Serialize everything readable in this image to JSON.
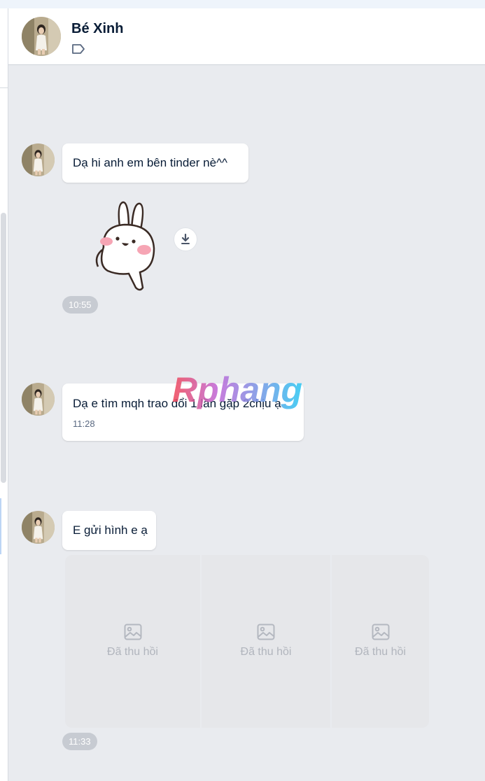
{
  "conversation": {
    "name": "Bé Xinh",
    "tag_icon": "tag-outline-icon"
  },
  "messages": {
    "m1": {
      "text": "Dạ hi anh em bên tinder nè^^"
    },
    "sticker": {
      "icon": "bunny-sticker",
      "download_icon": "download-icon",
      "time": "10:55"
    },
    "m2": {
      "text": "Dạ e tìm mqh trao đổi 1 lần gặp 2chịu ạ",
      "time": "11:28"
    },
    "m3": {
      "text": "E gửi hình e ạ"
    },
    "images": {
      "items": [
        {
          "label": "Đã thu hồi",
          "icon": "image-placeholder-icon"
        },
        {
          "label": "Đã thu hồi",
          "icon": "image-placeholder-icon"
        },
        {
          "label": "Đã thu hồi",
          "icon": "image-placeholder-icon"
        }
      ],
      "time": "11:33"
    }
  },
  "watermark": {
    "text": "Rphang"
  },
  "colors": {
    "background": "#e9ebef",
    "bubble": "#ffffff",
    "text": "#081c36",
    "time_pill": "#c7cbd2"
  }
}
